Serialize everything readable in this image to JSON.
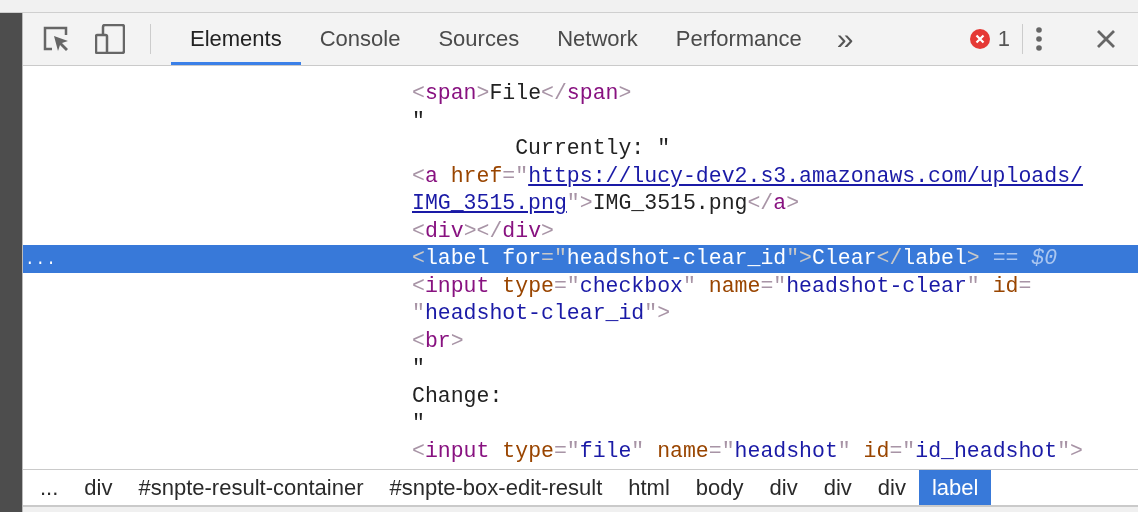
{
  "toolbar": {
    "tabs": [
      {
        "label": "Elements",
        "selected": true
      },
      {
        "label": "Console",
        "selected": false
      },
      {
        "label": "Sources",
        "selected": false
      },
      {
        "label": "Network",
        "selected": false
      },
      {
        "label": "Performance",
        "selected": false
      }
    ],
    "more": "»",
    "error_count": "1"
  },
  "code_lines": [
    {
      "selected": false,
      "tokens": [
        {
          "kind": "punct",
          "text": "<"
        },
        {
          "kind": "tag",
          "text": "span"
        },
        {
          "kind": "punct",
          "text": ">"
        },
        {
          "kind": "text",
          "text": "File"
        },
        {
          "kind": "punct",
          "text": "</"
        },
        {
          "kind": "tag",
          "text": "span"
        },
        {
          "kind": "punct",
          "text": ">"
        }
      ]
    },
    {
      "selected": false,
      "tokens": [
        {
          "kind": "text",
          "text": "\""
        }
      ]
    },
    {
      "selected": false,
      "tokens": [
        {
          "kind": "text",
          "text": "        Currently: \""
        }
      ]
    },
    {
      "selected": false,
      "tokens": [
        {
          "kind": "punct",
          "text": "<"
        },
        {
          "kind": "tag",
          "text": "a"
        },
        {
          "kind": "attr",
          "text": " href"
        },
        {
          "kind": "punct",
          "text": "=\""
        },
        {
          "kind": "link",
          "text": "https://lucy-dev2.s3.amazonaws.com/uploads/"
        }
      ]
    },
    {
      "selected": false,
      "tokens": [
        {
          "kind": "link",
          "text": "IMG_3515.png"
        },
        {
          "kind": "punct",
          "text": "\">"
        },
        {
          "kind": "text",
          "text": "IMG_3515.png"
        },
        {
          "kind": "punct",
          "text": "</"
        },
        {
          "kind": "tag",
          "text": "a"
        },
        {
          "kind": "punct",
          "text": ">"
        }
      ]
    },
    {
      "selected": false,
      "tokens": [
        {
          "kind": "punct",
          "text": "<"
        },
        {
          "kind": "tag",
          "text": "div"
        },
        {
          "kind": "punct",
          "text": "></"
        },
        {
          "kind": "tag",
          "text": "div"
        },
        {
          "kind": "punct",
          "text": ">"
        }
      ]
    },
    {
      "selected": true,
      "marker": "...",
      "tokens": [
        {
          "kind": "punct",
          "text": "<"
        },
        {
          "kind": "tag",
          "text": "label"
        },
        {
          "kind": "attr",
          "text": " for"
        },
        {
          "kind": "punct",
          "text": "=\""
        },
        {
          "kind": "value",
          "text": "headshot-clear_id"
        },
        {
          "kind": "punct",
          "text": "\">"
        },
        {
          "kind": "text",
          "text": "Clear"
        },
        {
          "kind": "punct",
          "text": "</"
        },
        {
          "kind": "tag",
          "text": "label"
        },
        {
          "kind": "punct",
          "text": ">"
        },
        {
          "kind": "ref",
          "text": " == $0"
        }
      ]
    },
    {
      "selected": false,
      "tokens": [
        {
          "kind": "punct",
          "text": "<"
        },
        {
          "kind": "tag",
          "text": "input"
        },
        {
          "kind": "attr",
          "text": " type"
        },
        {
          "kind": "punct",
          "text": "=\""
        },
        {
          "kind": "value",
          "text": "checkbox"
        },
        {
          "kind": "punct",
          "text": "\""
        },
        {
          "kind": "attr",
          "text": " name"
        },
        {
          "kind": "punct",
          "text": "=\""
        },
        {
          "kind": "value",
          "text": "headshot-clear"
        },
        {
          "kind": "punct",
          "text": "\""
        },
        {
          "kind": "attr",
          "text": " id"
        },
        {
          "kind": "punct",
          "text": "="
        }
      ]
    },
    {
      "selected": false,
      "tokens": [
        {
          "kind": "punct",
          "text": "\""
        },
        {
          "kind": "value",
          "text": "headshot-clear_id"
        },
        {
          "kind": "punct",
          "text": "\">"
        }
      ]
    },
    {
      "selected": false,
      "tokens": [
        {
          "kind": "punct",
          "text": "<"
        },
        {
          "kind": "tag",
          "text": "br"
        },
        {
          "kind": "punct",
          "text": ">"
        }
      ]
    },
    {
      "selected": false,
      "tokens": [
        {
          "kind": "text",
          "text": "\""
        }
      ]
    },
    {
      "selected": false,
      "tokens": [
        {
          "kind": "text",
          "text": "Change:"
        }
      ]
    },
    {
      "selected": false,
      "tokens": [
        {
          "kind": "text",
          "text": "\""
        }
      ]
    },
    {
      "selected": false,
      "tokens": [
        {
          "kind": "punct",
          "text": "<"
        },
        {
          "kind": "tag",
          "text": "input"
        },
        {
          "kind": "attr",
          "text": " type"
        },
        {
          "kind": "punct",
          "text": "=\""
        },
        {
          "kind": "value",
          "text": "file"
        },
        {
          "kind": "punct",
          "text": "\""
        },
        {
          "kind": "attr",
          "text": " name"
        },
        {
          "kind": "punct",
          "text": "=\""
        },
        {
          "kind": "value",
          "text": "headshot"
        },
        {
          "kind": "punct",
          "text": "\""
        },
        {
          "kind": "attr",
          "text": " id"
        },
        {
          "kind": "punct",
          "text": "=\""
        },
        {
          "kind": "value",
          "text": "id_headshot"
        },
        {
          "kind": "punct",
          "text": "\">"
        }
      ]
    }
  ],
  "breadcrumbs": [
    {
      "label": "...",
      "selected": false
    },
    {
      "label": "div",
      "selected": false
    },
    {
      "label": "#snpte-result-container",
      "selected": false
    },
    {
      "label": "#snpte-box-edit-result",
      "selected": false
    },
    {
      "label": "html",
      "selected": false
    },
    {
      "label": "body",
      "selected": false
    },
    {
      "label": "div",
      "selected": false
    },
    {
      "label": "div",
      "selected": false
    },
    {
      "label": "div",
      "selected": false
    },
    {
      "label": "label",
      "selected": true
    }
  ]
}
